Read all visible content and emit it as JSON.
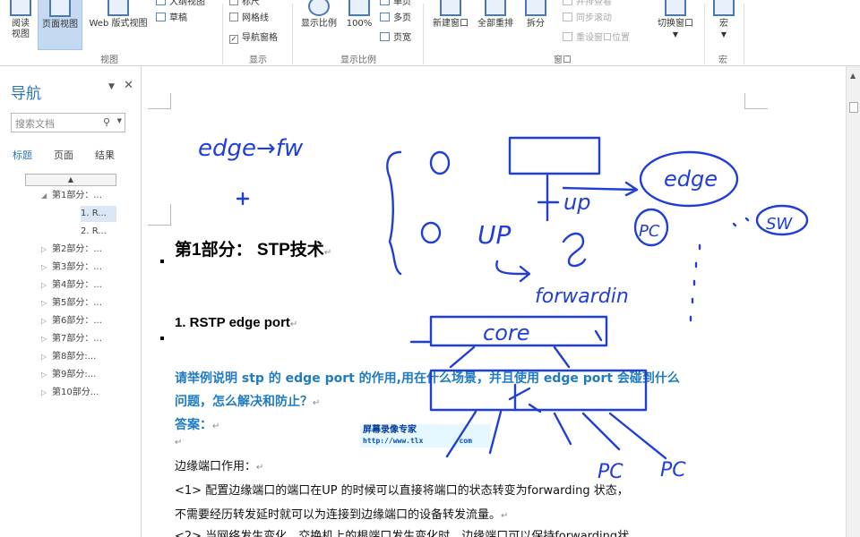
{
  "ribbon": {
    "buttons": {
      "read": "阅读\n视图",
      "page": "页面视图",
      "web": "Web 版式视图",
      "zoom": "显示比例",
      "zoom100": "100%",
      "new_window": "新建窗口",
      "arrange_all": "全部重排",
      "split": "拆分",
      "switch_window": "切换窗口",
      "macros": "宏"
    },
    "small": {
      "outline": "大纲视图",
      "draft": "草稿",
      "ruler": "标尺",
      "gridlines": "网格线",
      "nav_pane": "导航窗格",
      "one_page": "单页",
      "multi_page": "多页",
      "page_width": "页宽",
      "side_by_side": "并排查看",
      "sync_scroll": "同步滚动",
      "reset_window": "重设窗口位置"
    },
    "groups": {
      "views": "视图",
      "show": "显示",
      "zoom": "显示比例",
      "window": "窗口",
      "macros": "宏"
    }
  },
  "nav": {
    "title": "导航",
    "search_placeholder": "搜索文档",
    "tabs": [
      "标题",
      "页面",
      "结果"
    ],
    "items": [
      {
        "label": "第1部分：...",
        "indent": 1,
        "expanded": true
      },
      {
        "label": "1. R...",
        "indent": 2,
        "selected": true
      },
      {
        "label": "2. R...",
        "indent": 2
      },
      {
        "label": "第2部分：...",
        "indent": 1
      },
      {
        "label": "第3部分：...",
        "indent": 1
      },
      {
        "label": "第4部分：...",
        "indent": 1
      },
      {
        "label": "第5部分：...",
        "indent": 1
      },
      {
        "label": "第6部分：...",
        "indent": 1
      },
      {
        "label": "第7部分：...",
        "indent": 1
      },
      {
        "label": "第8部分:...",
        "indent": 1
      },
      {
        "label": "第9部分:...",
        "indent": 1
      },
      {
        "label": "第10部分...",
        "indent": 1
      }
    ]
  },
  "document": {
    "heading1": "第1部分： STP技术",
    "heading2": "1.   RSTP edge port",
    "question_line1": "请举例说明  stp  的  edge port  的作用,用在什么场景，并且使用  edge port  会碰到什么",
    "question_line2": "问题，怎么解决和防止？",
    "answer_label": "答案：",
    "para_title": "边缘端口作用：",
    "para1_line1": "<1>    配置边缘端口的端口在UP  的时候可以直接将端口的状态转变为forwarding  状态，",
    "para1_line2": "不需要经历转发延时就可以为连接到边缘端口的设备转发流量。",
    "para2_partial": "<2>    当网络发生变化，交换机上的根端口发生变化时，边缘端口可以保持forwarding状"
  },
  "watermark": {
    "title": "屏幕录像专家",
    "url": "http://www.tlx",
    "url_tail": "com"
  },
  "ink_labels": {
    "edge_fw": "edge→fw",
    "up1": "up",
    "edge": "edge",
    "pc1": "PC",
    "sw": "SW",
    "up2": "UP",
    "forwarding": "forwardin",
    "core": "core",
    "pc2": "PC",
    "pc3": "PC"
  }
}
